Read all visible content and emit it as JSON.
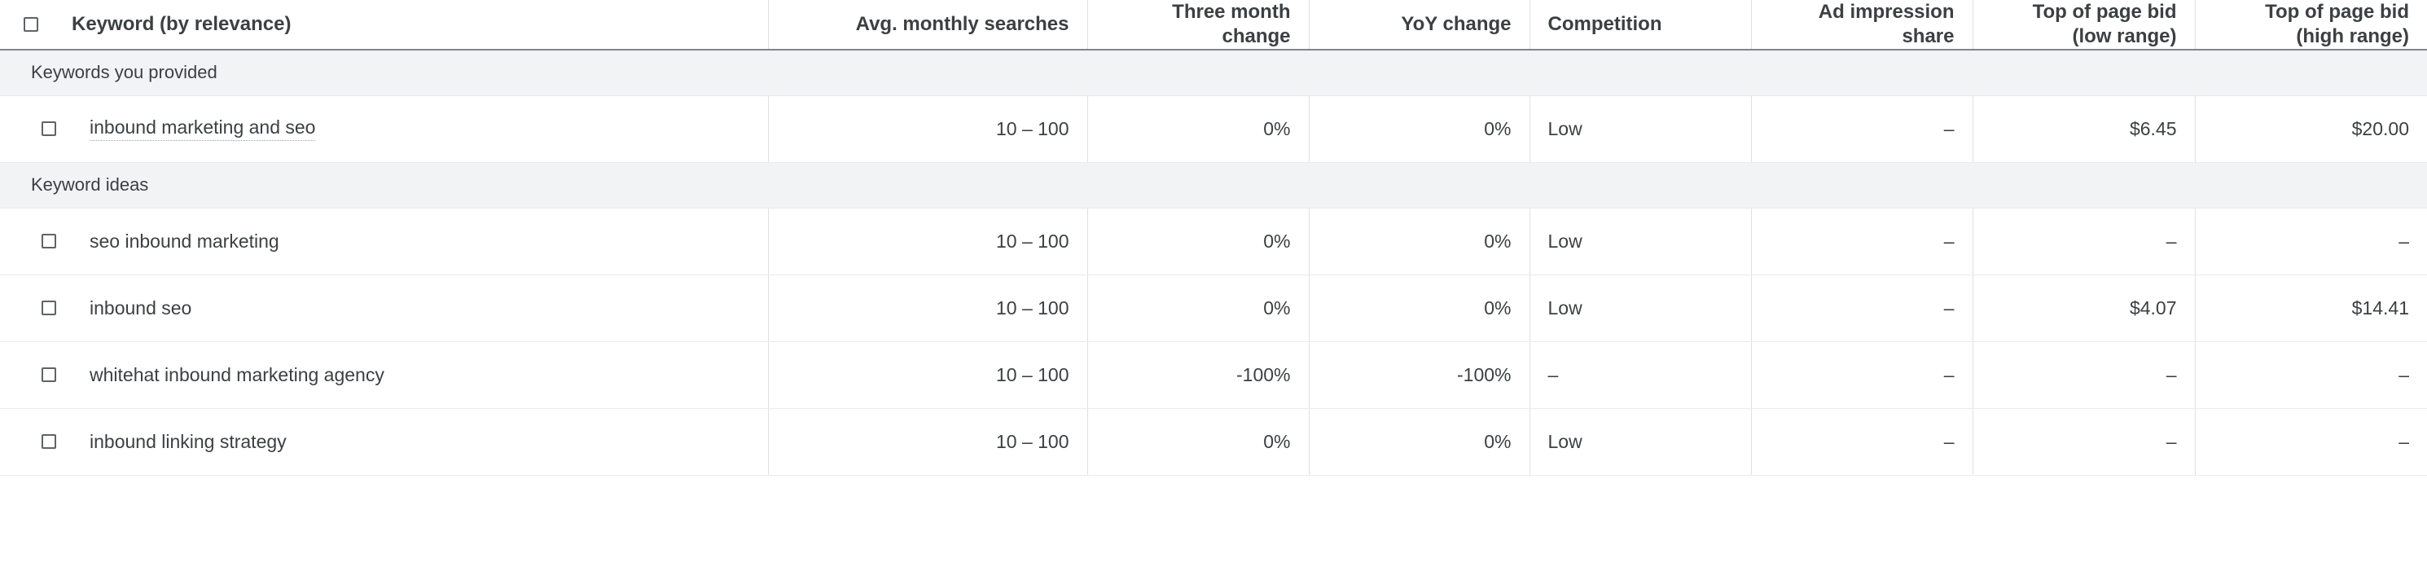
{
  "table": {
    "select_all_checkbox": "unchecked",
    "columns": [
      {
        "id": "keyword",
        "label": "Keyword (by relevance)",
        "align": "left"
      },
      {
        "id": "avg_monthly",
        "label": "Avg. monthly searches",
        "align": "right"
      },
      {
        "id": "three_month",
        "label": "Three month change",
        "align": "right"
      },
      {
        "id": "yoy",
        "label": "YoY change",
        "align": "right"
      },
      {
        "id": "competition",
        "label": "Competition",
        "align": "left"
      },
      {
        "id": "ad_share",
        "label": "Ad impression share",
        "align": "right"
      },
      {
        "id": "bid_low",
        "label": "Top of page bid (low range)",
        "align": "right"
      },
      {
        "id": "bid_high",
        "label": "Top of page bid (high range)",
        "align": "right"
      }
    ],
    "groups": [
      {
        "id": "keywords-you-provided",
        "label": "Keywords you provided",
        "rows": [
          {
            "checkbox": "unchecked",
            "keyword": "inbound marketing and seo",
            "keyword_editable": true,
            "avg_monthly": "10 – 100",
            "three_month": "0%",
            "yoy": "0%",
            "competition": "Low",
            "ad_share": "–",
            "bid_low": "$6.45",
            "bid_high": "$20.00"
          }
        ]
      },
      {
        "id": "keyword-ideas",
        "label": "Keyword ideas",
        "rows": [
          {
            "checkbox": "unchecked",
            "keyword": "seo inbound marketing",
            "keyword_editable": false,
            "avg_monthly": "10 – 100",
            "three_month": "0%",
            "yoy": "0%",
            "competition": "Low",
            "ad_share": "–",
            "bid_low": "–",
            "bid_high": "–"
          },
          {
            "checkbox": "unchecked",
            "keyword": "inbound seo",
            "keyword_editable": false,
            "avg_monthly": "10 – 100",
            "three_month": "0%",
            "yoy": "0%",
            "competition": "Low",
            "ad_share": "–",
            "bid_low": "$4.07",
            "bid_high": "$14.41"
          },
          {
            "checkbox": "unchecked",
            "keyword": "whitehat inbound marketing agency",
            "keyword_editable": false,
            "avg_monthly": "10 – 100",
            "three_month": "-100%",
            "yoy": "-100%",
            "competition": "–",
            "ad_share": "–",
            "bid_low": "–",
            "bid_high": "–"
          },
          {
            "checkbox": "unchecked",
            "keyword": "inbound linking strategy",
            "keyword_editable": false,
            "avg_monthly": "10 – 100",
            "three_month": "0%",
            "yoy": "0%",
            "competition": "Low",
            "ad_share": "–",
            "bid_low": "–",
            "bid_high": "–"
          }
        ]
      }
    ]
  },
  "colors": {
    "text": "#3c4043",
    "group_bg": "#f1f3f4",
    "row_border": "#e8eaed",
    "column_border": "#e0e0e0",
    "header_rule": "#80868b",
    "checkbox_border": "#5f6368"
  }
}
